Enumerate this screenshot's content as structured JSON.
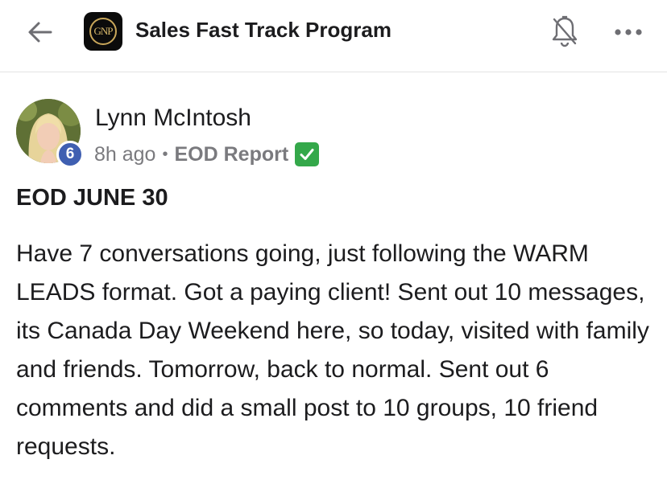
{
  "header": {
    "back_icon": "arrow-left-icon",
    "logo_text": "GNP",
    "title": "Sales Fast Track Program",
    "bell_icon": "bell-off-icon",
    "more_icon": "more-horizontal-icon"
  },
  "post": {
    "author": {
      "name": "Lynn McIntosh",
      "level": "6"
    },
    "time_ago": "8h ago",
    "separator": "•",
    "category": "EOD Report",
    "category_emoji": "check-mark-button-icon",
    "title": "EOD JUNE 30",
    "body": "Have 7 conversations going, just following the WARM LEADS format. Got a paying client! Sent out 10 messages, its Canada Day Weekend here, so today, visited with family and friends. Tomorrow, back to normal. Sent out 6 comments and did a small post to 10 groups, 10 friend requests."
  },
  "colors": {
    "level_badge": "#3f5fb1",
    "meta_text": "#7a7a7e",
    "emoji_green": "#34a84a",
    "logo_gold": "#c9a75a"
  }
}
